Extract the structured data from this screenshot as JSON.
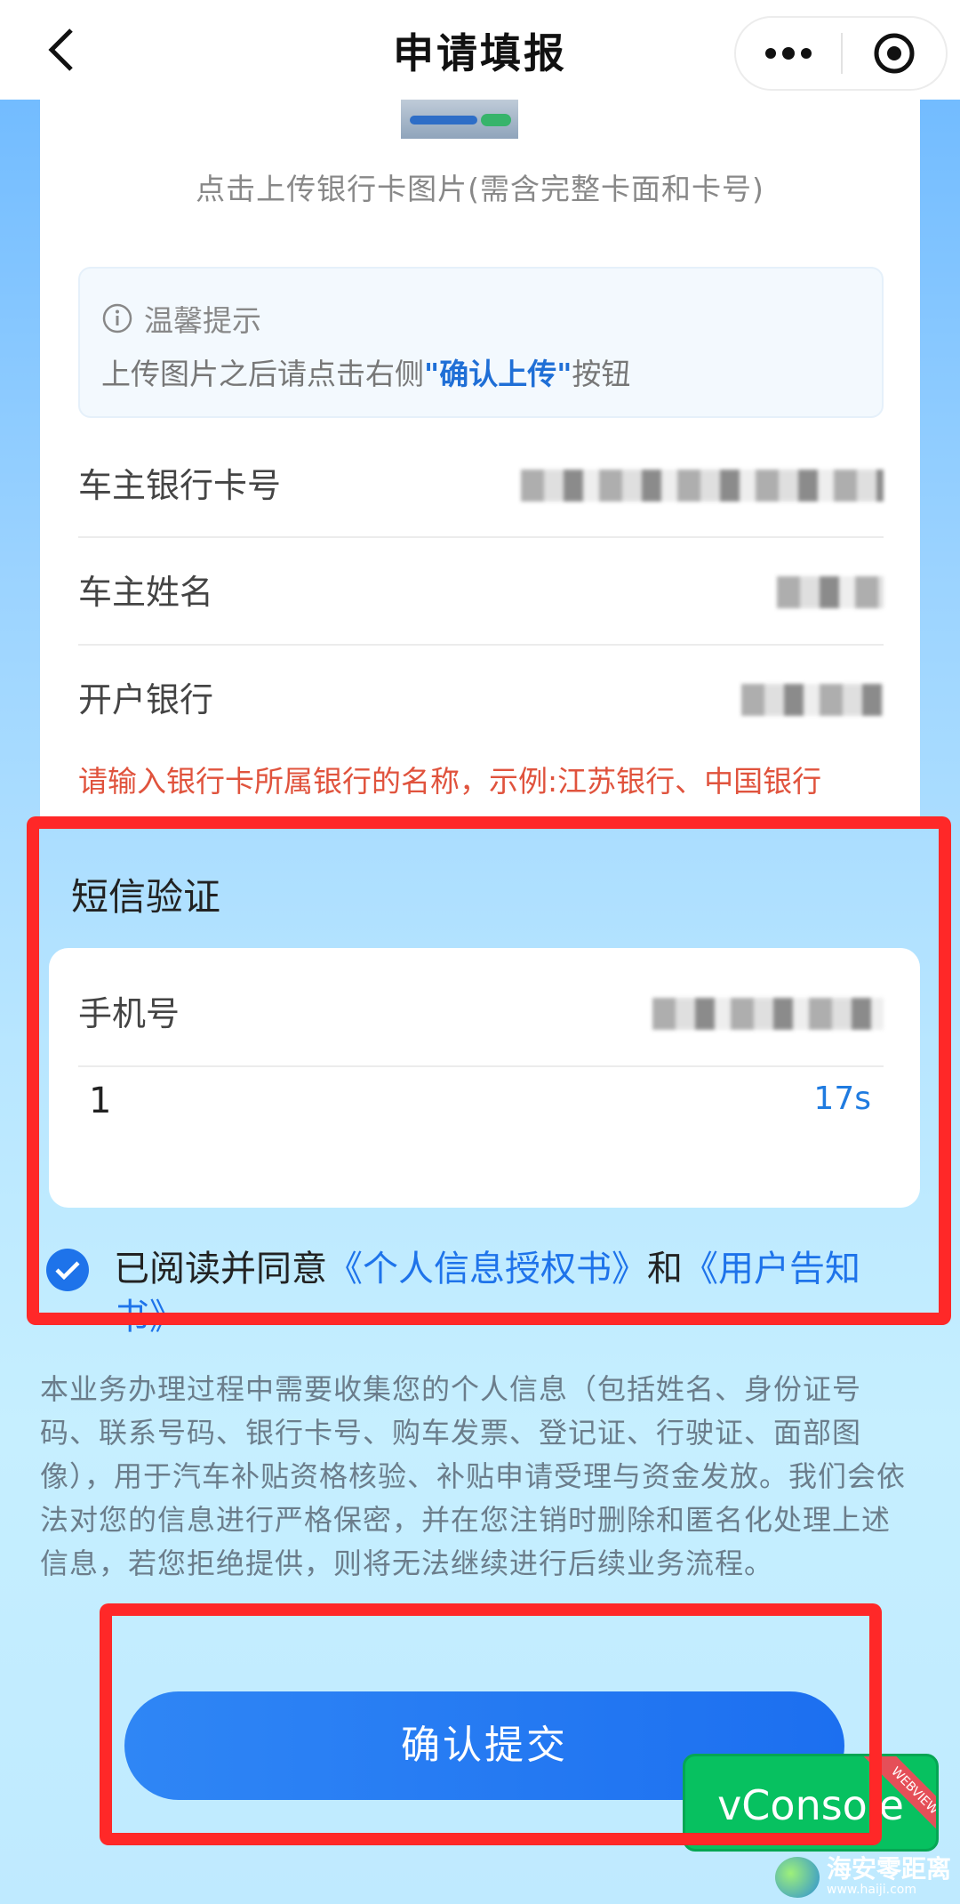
{
  "nav": {
    "title": "申请填报",
    "back_icon": "back-chevron-icon",
    "more_icon": "more-dots-icon",
    "target_icon": "target-circle-icon"
  },
  "upload": {
    "hint": "点击上传银行卡图片(需含完整卡面和卡号)"
  },
  "tip": {
    "title": "温馨提示",
    "body_prefix": "上传图片之后请点击右侧",
    "body_highlight": "\"确认上传\"",
    "body_suffix": "按钮"
  },
  "form": {
    "card_number_label": "车主银行卡号",
    "owner_name_label": "车主姓名",
    "bank_label": "开户银行",
    "bank_warning": "请输入银行卡所属银行的名称，示例:江苏银行、中国银行"
  },
  "sms": {
    "title": "短信验证",
    "phone_label": "手机号",
    "code_value": "1",
    "countdown": "17s"
  },
  "agreement": {
    "prefix": "已阅读并同意",
    "link1": "《个人信息授权书》",
    "middle": "和",
    "link2": "《用户告知书》"
  },
  "notice": "本业务办理过程中需要收集您的个人信息（包括姓名、身份证号码、联系号码、银行卡号、购车发票、登记证、行驶证、面部图像），用于汽车补贴资格核验、补贴申请受理与资金发放。我们会依法对您的信息进行严格保密，并在您注销时删除和匿名化处理上述信息，若您拒绝提供，则将无法继续进行后续业务流程。",
  "submit_label": "确认提交",
  "vconsole": {
    "label": "vConsole",
    "ribbon": "WEBVIEW"
  },
  "watermark": {
    "name": "海安零距离",
    "url": "www.haiji.com"
  },
  "colors": {
    "accent": "#1e73ea",
    "warning": "#e0533d",
    "annotation": "#ff2828",
    "vconsole": "#07c160"
  }
}
